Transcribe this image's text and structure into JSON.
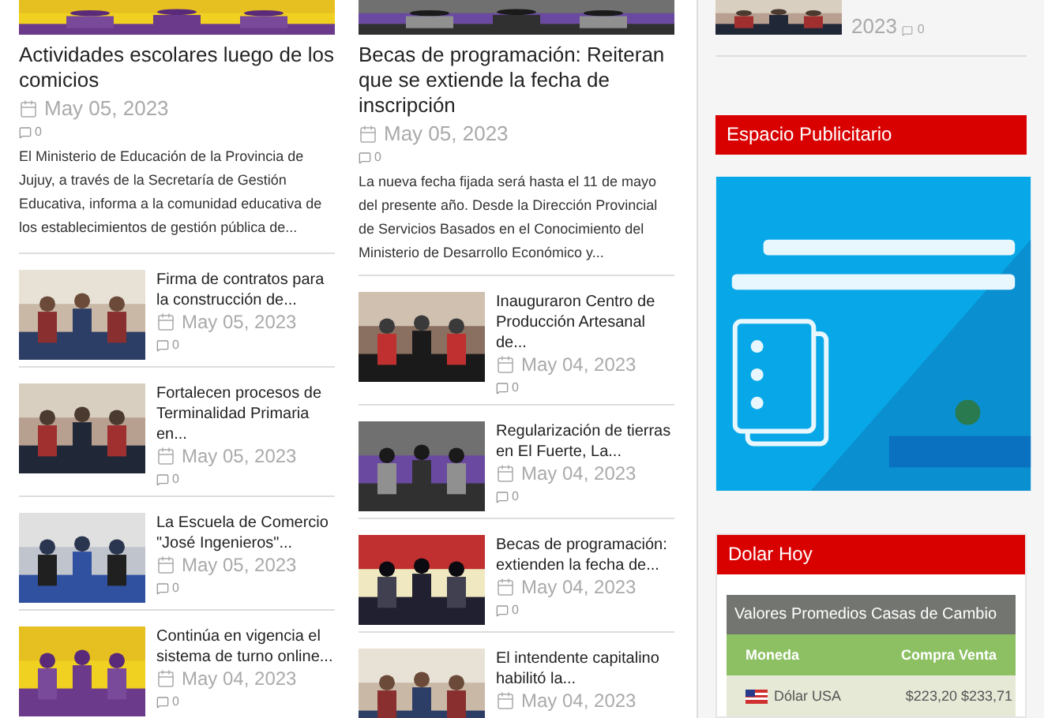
{
  "columns": [
    {
      "feature": {
        "title": "Actividades escolares luego de los comicios",
        "date": "May 05, 2023",
        "comments": "0",
        "excerpt": "El Ministerio de Educación de la Provincia de Jujuy, a través de la Secretaría de Gestión Educativa, informa a la comunidad educativa de los establecimientos de gestión pública de..."
      },
      "items": [
        {
          "title": "Firma de contratos para la construcción de...",
          "date": "May 05, 2023",
          "comments": "0"
        },
        {
          "title": "Fortalecen procesos de Terminalidad Primaria en...",
          "date": "May 05, 2023",
          "comments": "0"
        },
        {
          "title": "La Escuela de Comercio \"José Ingenieros\"...",
          "date": "May 05, 2023",
          "comments": "0"
        },
        {
          "title": "Continúa en vigencia el sistema de turno online...",
          "date": "May 04, 2023",
          "comments": "0"
        }
      ]
    },
    {
      "feature": {
        "title": "Becas de programación: Reiteran que se extiende la fecha de inscripción",
        "date": "May 05, 2023",
        "comments": "0",
        "excerpt": "La nueva fecha fijada será hasta el 11 de mayo del presente año. Desde la Dirección Provincial de Servicios Basados en el Conocimiento del Ministerio de Desarrollo Económico y..."
      },
      "items": [
        {
          "title": "Inauguraron Centro de Producción Artesanal de...",
          "date": "May 04, 2023",
          "comments": "0"
        },
        {
          "title": "Regularización de tierras en El Fuerte, La...",
          "date": "May 04, 2023",
          "comments": "0"
        },
        {
          "title": "Becas de programación: extienden la fecha de...",
          "date": "May 04, 2023",
          "comments": "0"
        },
        {
          "title": "El intendente capitalino habilitó la...",
          "date": "May 04, 2023"
        }
      ]
    }
  ],
  "sidebar": {
    "top_item": {
      "date": "2023",
      "comments": "0"
    },
    "ad": {
      "title": "Espacio Publicitario"
    },
    "dolar": {
      "title": "Dolar Hoy",
      "table_title": "Valores Promedios Casas de Cambio",
      "columns": [
        "Moneda",
        "Compra Venta"
      ],
      "rows": [
        {
          "currency": "Dólar USA",
          "values": "$223,20 $233,71"
        }
      ]
    }
  }
}
